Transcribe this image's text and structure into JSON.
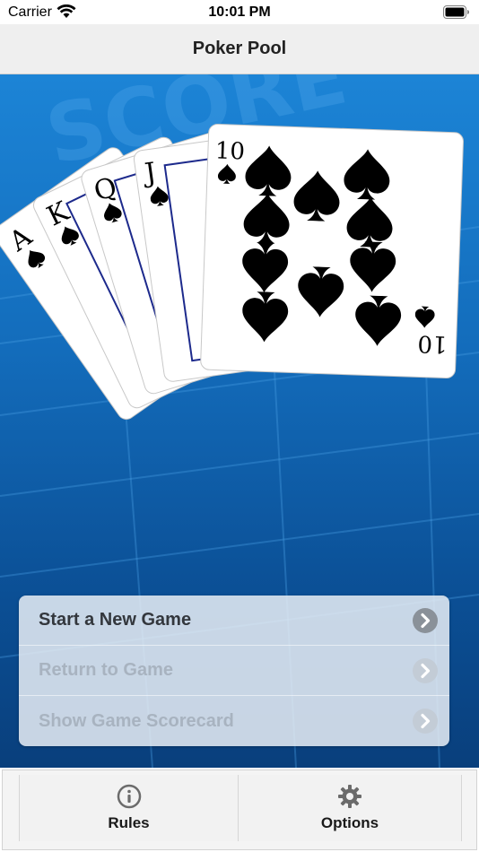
{
  "status_bar": {
    "carrier": "Carrier",
    "time": "10:01 PM"
  },
  "nav": {
    "title": "Poker Pool"
  },
  "hero": {
    "cards": [
      {
        "rank": "A",
        "suit": "spade"
      },
      {
        "rank": "K",
        "suit": "spade"
      },
      {
        "rank": "Q",
        "suit": "spade"
      },
      {
        "rank": "J",
        "suit": "spade"
      },
      {
        "rank": "10",
        "suit": "spade"
      }
    ],
    "background_text": "SCORE"
  },
  "menu": {
    "items": [
      {
        "label": "Start a New Game",
        "enabled": true
      },
      {
        "label": "Return to Game",
        "enabled": false
      },
      {
        "label": "Show Game Scorecard",
        "enabled": false
      }
    ]
  },
  "tabs": [
    {
      "label": "Rules",
      "icon": "info-icon"
    },
    {
      "label": "Options",
      "icon": "gear-icon"
    }
  ],
  "colors": {
    "hero_top": "#1c84d6",
    "hero_bottom": "#093f7c",
    "menu_enabled_text": "#33373d",
    "menu_disabled_text": "#a8b3c0"
  }
}
